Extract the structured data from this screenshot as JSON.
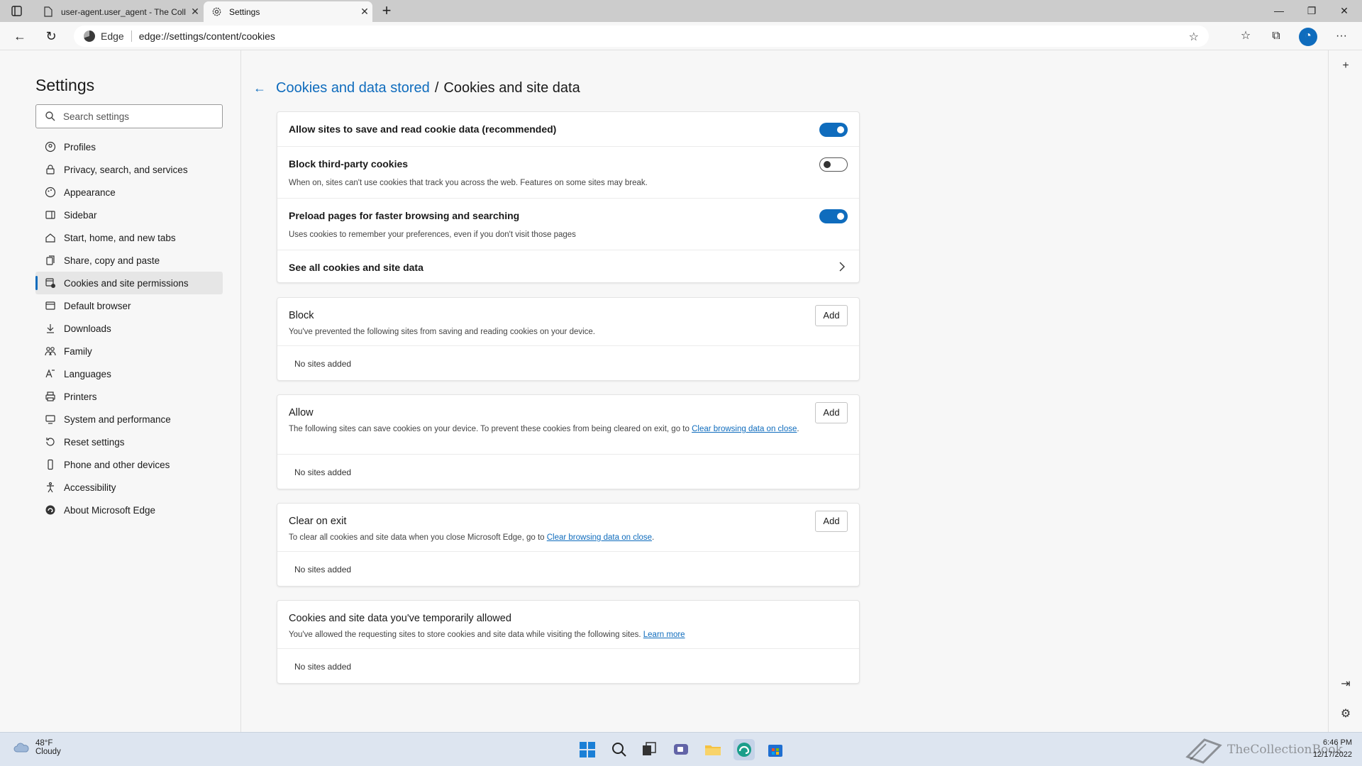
{
  "browser": {
    "tabs": [
      {
        "title": "user-agent.user_agent - The Coll",
        "active": false
      },
      {
        "title": "Settings",
        "active": true
      }
    ],
    "address": {
      "site_label": "Edge",
      "url": "edge://settings/content/cookies"
    }
  },
  "sidebar": {
    "title": "Settings",
    "search_placeholder": "Search settings",
    "items": [
      {
        "label": "Profiles",
        "icon": "profile-icon"
      },
      {
        "label": "Privacy, search, and services",
        "icon": "lock-icon"
      },
      {
        "label": "Appearance",
        "icon": "appearance-icon"
      },
      {
        "label": "Sidebar",
        "icon": "sidebar-icon"
      },
      {
        "label": "Start, home, and new tabs",
        "icon": "home-icon"
      },
      {
        "label": "Share, copy and paste",
        "icon": "share-icon"
      },
      {
        "label": "Cookies and site permissions",
        "icon": "cookies-icon",
        "selected": true
      },
      {
        "label": "Default browser",
        "icon": "browser-icon"
      },
      {
        "label": "Downloads",
        "icon": "download-icon"
      },
      {
        "label": "Family",
        "icon": "family-icon"
      },
      {
        "label": "Languages",
        "icon": "languages-icon"
      },
      {
        "label": "Printers",
        "icon": "printer-icon"
      },
      {
        "label": "System and performance",
        "icon": "system-icon"
      },
      {
        "label": "Reset settings",
        "icon": "reset-icon"
      },
      {
        "label": "Phone and other devices",
        "icon": "phone-icon"
      },
      {
        "label": "Accessibility",
        "icon": "accessibility-icon"
      },
      {
        "label": "About Microsoft Edge",
        "icon": "edge-icon"
      }
    ]
  },
  "page": {
    "breadcrumb_parent": "Cookies and data stored",
    "breadcrumb_sep": "/",
    "breadcrumb_current": "Cookies and site data",
    "settings": {
      "allow_sites": {
        "label": "Allow sites to save and read cookie data (recommended)",
        "enabled": true
      },
      "block_third_party": {
        "label": "Block third-party cookies",
        "description": "When on, sites can't use cookies that track you across the web. Features on some sites may break.",
        "enabled": false
      },
      "preload": {
        "label": "Preload pages for faster browsing and searching",
        "description": "Uses cookies to remember your preferences, even if you don't visit those pages",
        "enabled": true
      },
      "see_all": {
        "label": "See all cookies and site data"
      }
    },
    "block": {
      "title": "Block",
      "description": "You've prevented the following sites from saving and reading cookies on your device.",
      "add_label": "Add",
      "empty": "No sites added"
    },
    "allow": {
      "title": "Allow",
      "description_prefix": "The following sites can save cookies on your device. To prevent these cookies from being cleared on exit, go to ",
      "link_text": "Clear browsing data on close",
      "description_suffix": ".",
      "add_label": "Add",
      "empty": "No sites added"
    },
    "clear_on_exit": {
      "title": "Clear on exit",
      "description_prefix": "To clear all cookies and site data when you close Microsoft Edge, go to ",
      "link_text": "Clear browsing data on close",
      "description_suffix": ".",
      "add_label": "Add",
      "empty": "No sites added"
    },
    "temp_allowed": {
      "title": "Cookies and site data you've temporarily allowed",
      "description_prefix": "You've allowed the requesting sites to store cookies and site data while visiting the following sites. ",
      "link_text": "Learn more",
      "empty": "No sites added"
    }
  },
  "taskbar": {
    "weather_temp": "48°F",
    "weather_cond": "Cloudy",
    "time": "6:46 PM",
    "date": "12/17/2022",
    "watermark": "TheCollectionBook"
  },
  "colors": {
    "accent": "#0f6cbd",
    "taskbar": "#dde5f0"
  }
}
